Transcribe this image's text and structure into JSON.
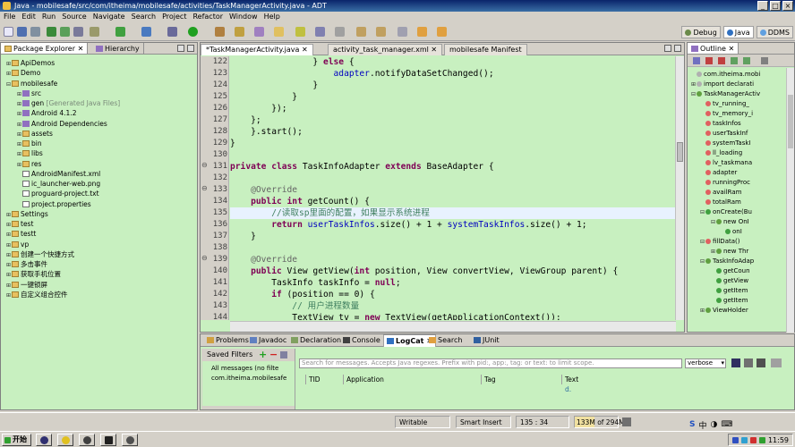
{
  "window": {
    "title": "Java - mobilesafe/src/com/itheima/mobilesafe/activities/TaskManagerActivity.java - ADT"
  },
  "menu": [
    "File",
    "Edit",
    "Run",
    "Source",
    "Navigate",
    "Search",
    "Project",
    "Refactor",
    "Window",
    "Help"
  ],
  "perspectives": [
    {
      "label": "Debug",
      "color": "#6a8a4a"
    },
    {
      "label": "Java",
      "color": "#3070c0"
    },
    {
      "label": "DDMS",
      "color": "#60a0e0"
    }
  ],
  "package_explorer": {
    "tabs": [
      "Package Explorer",
      "Hierarchy"
    ],
    "items": [
      {
        "label": "ApiDemos",
        "depth": 0,
        "icon": "folder",
        "exp": "+"
      },
      {
        "label": "Demo",
        "depth": 0,
        "icon": "folder",
        "exp": "+"
      },
      {
        "label": "mobilesafe",
        "depth": 0,
        "icon": "folder",
        "exp": "-"
      },
      {
        "label": "src",
        "depth": 1,
        "icon": "pkg",
        "exp": "+"
      },
      {
        "label": "gen",
        "depth": 1,
        "icon": "pkg",
        "exp": "+",
        "extra": "[Generated Java Files]"
      },
      {
        "label": "Android 4.1.2",
        "depth": 1,
        "icon": "pkg",
        "exp": "+"
      },
      {
        "label": "Android Dependencies",
        "depth": 1,
        "icon": "pkg",
        "exp": "+"
      },
      {
        "label": "assets",
        "depth": 1,
        "icon": "folder",
        "exp": "+"
      },
      {
        "label": "bin",
        "depth": 1,
        "icon": "folder",
        "exp": "+"
      },
      {
        "label": "libs",
        "depth": 1,
        "icon": "folder",
        "exp": "+"
      },
      {
        "label": "res",
        "depth": 1,
        "icon": "folder",
        "exp": "+"
      },
      {
        "label": "AndroidManifest.xml",
        "depth": 1,
        "icon": "file",
        "exp": ""
      },
      {
        "label": "ic_launcher-web.png",
        "depth": 1,
        "icon": "file",
        "exp": ""
      },
      {
        "label": "proguard-project.txt",
        "depth": 1,
        "icon": "file",
        "exp": ""
      },
      {
        "label": "project.properties",
        "depth": 1,
        "icon": "file",
        "exp": ""
      },
      {
        "label": "Settings",
        "depth": 0,
        "icon": "folder",
        "exp": "+"
      },
      {
        "label": "test",
        "depth": 0,
        "icon": "folder",
        "exp": "+"
      },
      {
        "label": "testt",
        "depth": 0,
        "icon": "folder",
        "exp": "+"
      },
      {
        "label": "vp",
        "depth": 0,
        "icon": "folder",
        "exp": "+"
      },
      {
        "label": "创建一个快捷方式",
        "depth": 0,
        "icon": "folder",
        "exp": "+"
      },
      {
        "label": "多击事件",
        "depth": 0,
        "icon": "folder",
        "exp": "+"
      },
      {
        "label": "获取手机位置",
        "depth": 0,
        "icon": "folder",
        "exp": "+"
      },
      {
        "label": "一键锁屏",
        "depth": 0,
        "icon": "folder",
        "exp": "+"
      },
      {
        "label": "自定义组合控件",
        "depth": 0,
        "icon": "folder",
        "exp": "+"
      }
    ]
  },
  "editor": {
    "tabs": [
      "*TaskManagerActivity.java",
      "activity_task_manager.xml",
      "mobilesafe Manifest"
    ],
    "lines": [
      {
        "n": "122",
        "tokens": [
          [
            "",
            "                } "
          ],
          [
            "kw",
            "else"
          ],
          [
            "",
            " {"
          ]
        ]
      },
      {
        "n": "123",
        "tokens": [
          [
            "",
            "                    "
          ],
          [
            "fd",
            "adapter"
          ],
          [
            "",
            ".notifyDataSetChanged();"
          ]
        ]
      },
      {
        "n": "124",
        "tokens": [
          [
            "",
            "                }"
          ]
        ]
      },
      {
        "n": "125",
        "tokens": [
          [
            "",
            "            }"
          ]
        ]
      },
      {
        "n": "126",
        "tokens": [
          [
            "",
            "        });"
          ]
        ]
      },
      {
        "n": "127",
        "tokens": [
          [
            "",
            "    };"
          ]
        ]
      },
      {
        "n": "128",
        "tokens": [
          [
            "",
            "    }.start();"
          ]
        ]
      },
      {
        "n": "129",
        "tokens": [
          [
            "",
            "}"
          ]
        ]
      },
      {
        "n": "130",
        "tokens": []
      },
      {
        "n": "131",
        "tokens": [
          [
            "kw",
            "private class "
          ],
          [
            "",
            "TaskInfoAdapter "
          ],
          [
            "kw",
            "extends "
          ],
          [
            "",
            "BaseAdapter {"
          ]
        ],
        "ann": "-"
      },
      {
        "n": "132",
        "tokens": []
      },
      {
        "n": "133",
        "tokens": [
          [
            "an",
            "    @Override"
          ]
        ],
        "ann": "-"
      },
      {
        "n": "134",
        "tokens": [
          [
            "kw",
            "    public int "
          ],
          [
            "",
            "getCount() {"
          ]
        ]
      },
      {
        "n": "135",
        "tokens": [
          [
            "cm",
            "        //读取sp里面的配置，如果显示系统进程"
          ]
        ],
        "current": true
      },
      {
        "n": "136",
        "tokens": [
          [
            "kw",
            "        return "
          ],
          [
            "fd",
            "userTaskInfos"
          ],
          [
            "",
            ".size() + 1 + "
          ],
          [
            "fd",
            "systemTaskInfos"
          ],
          [
            "",
            ".size() + 1;"
          ]
        ]
      },
      {
        "n": "137",
        "tokens": [
          [
            "",
            "    }"
          ]
        ]
      },
      {
        "n": "138",
        "tokens": []
      },
      {
        "n": "139",
        "tokens": [
          [
            "an",
            "    @Override"
          ]
        ],
        "ann": "-"
      },
      {
        "n": "140",
        "tokens": [
          [
            "kw",
            "    public "
          ],
          [
            "",
            "View getView("
          ],
          [
            "kw",
            "int "
          ],
          [
            "",
            "position, View convertView, ViewGroup parent) {"
          ]
        ]
      },
      {
        "n": "141",
        "tokens": [
          [
            "",
            "        TaskInfo taskInfo = "
          ],
          [
            "kw",
            "null"
          ],
          [
            "",
            ";"
          ]
        ]
      },
      {
        "n": "142",
        "tokens": [
          [
            "kw",
            "        if "
          ],
          [
            "",
            "(position == 0) {"
          ]
        ]
      },
      {
        "n": "143",
        "tokens": [
          [
            "cm",
            "            // 用户进程数量"
          ]
        ]
      },
      {
        "n": "144",
        "tokens": [
          [
            "",
            "            TextView tv = "
          ],
          [
            "kw",
            "new "
          ],
          [
            "",
            "TextView(getApplicationContext());"
          ]
        ]
      }
    ]
  },
  "outline": {
    "title": "Outline",
    "items": [
      {
        "label": "com.itheima.mobi",
        "x": 0,
        "dot": "#b0b0b0",
        "exp": ""
      },
      {
        "label": "import declarati",
        "x": 0,
        "dot": "#b0b0b0",
        "exp": "+"
      },
      {
        "label": "TaskManagerActiv",
        "x": 0,
        "dot": "#60a040",
        "exp": "-"
      },
      {
        "label": "tv_running_",
        "x": 10,
        "dot": "#e06060",
        "exp": ""
      },
      {
        "label": "tv_memory_i",
        "x": 10,
        "dot": "#e06060",
        "exp": ""
      },
      {
        "label": "taskInfos",
        "x": 10,
        "dot": "#e06060",
        "exp": ""
      },
      {
        "label": "userTaskInf",
        "x": 10,
        "dot": "#e06060",
        "exp": ""
      },
      {
        "label": "systemTaskI",
        "x": 10,
        "dot": "#e06060",
        "exp": ""
      },
      {
        "label": "ll_loading",
        "x": 10,
        "dot": "#e06060",
        "exp": ""
      },
      {
        "label": "lv_taskmana",
        "x": 10,
        "dot": "#e06060",
        "exp": ""
      },
      {
        "label": "adapter",
        "x": 10,
        "dot": "#e06060",
        "exp": ""
      },
      {
        "label": "runningProc",
        "x": 10,
        "dot": "#e06060",
        "exp": ""
      },
      {
        "label": "availRam",
        "x": 10,
        "dot": "#e06060",
        "exp": ""
      },
      {
        "label": "totalRam",
        "x": 10,
        "dot": "#e06060",
        "exp": ""
      },
      {
        "label": "onCreate(Bu",
        "x": 10,
        "dot": "#40a040",
        "exp": "-"
      },
      {
        "label": "new OnI",
        "x": 22,
        "dot": "#60a040",
        "exp": "-"
      },
      {
        "label": "onI",
        "x": 32,
        "dot": "#40a040",
        "exp": ""
      },
      {
        "label": "fillData()",
        "x": 10,
        "dot": "#e06060",
        "exp": "-"
      },
      {
        "label": "new Thr",
        "x": 22,
        "dot": "#60a040",
        "exp": "+"
      },
      {
        "label": "TaskInfoAdap",
        "x": 10,
        "dot": "#60a040",
        "exp": "-"
      },
      {
        "label": "getCoun",
        "x": 22,
        "dot": "#40a040",
        "exp": ""
      },
      {
        "label": "getView",
        "x": 22,
        "dot": "#40a040",
        "exp": ""
      },
      {
        "label": "getItem",
        "x": 22,
        "dot": "#40a040",
        "exp": ""
      },
      {
        "label": "getItem",
        "x": 22,
        "dot": "#40a040",
        "exp": ""
      },
      {
        "label": "ViewHolder",
        "x": 10,
        "dot": "#60a040",
        "exp": "+"
      }
    ]
  },
  "bottom": {
    "tabs": [
      "Problems",
      "Javadoc",
      "Declaration",
      "Console",
      "LogCat",
      "Search",
      "JUnit"
    ],
    "active_tab": "LogCat",
    "saved_filters_label": "Saved Filters",
    "filters": [
      "All messages (no filte",
      "com.itheima.mobilesafe"
    ],
    "search_placeholder": "Search for messages. Accepts Java regexes. Prefix with pid:, app:, tag: or text: to limit scope.",
    "verbose": "verbose",
    "columns": [
      "",
      "TID",
      "Application",
      "Tag",
      "Text"
    ],
    "row_text": "d."
  },
  "status": {
    "writable": "Writable",
    "insert": "Smart Insert",
    "position": "135 : 34",
    "memory_used": "133M",
    "memory_total": "of 294M",
    "memory_fraction": 0.45
  },
  "taskbar": {
    "start": "开始",
    "time": "11:59",
    "ime": "中"
  }
}
